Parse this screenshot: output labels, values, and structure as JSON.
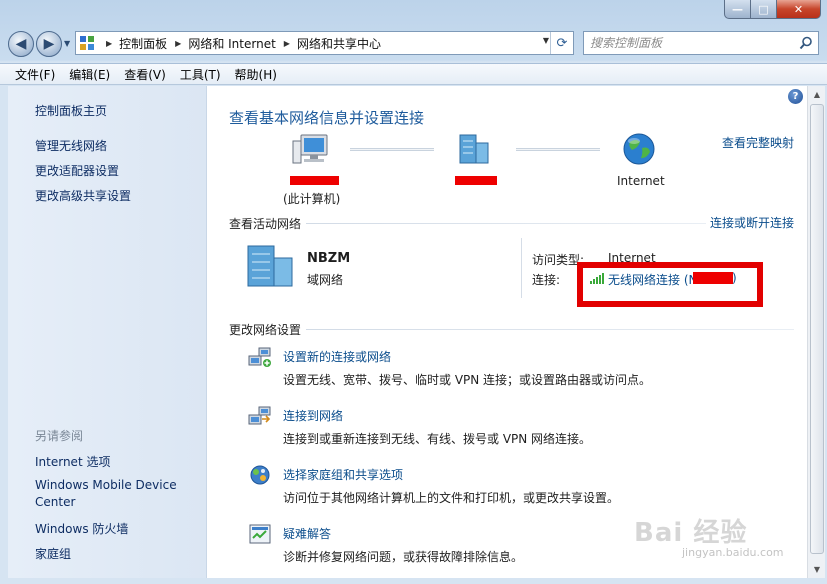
{
  "window": {
    "caption": {
      "minimize": "—",
      "maximize": "□",
      "close": "✕"
    }
  },
  "nav": {
    "back_icon": "back-arrow-icon",
    "forward_icon": "forward-arrow-icon",
    "breadcrumb": [
      "控制面板",
      "网络和 Internet",
      "网络和共享中心"
    ],
    "search_placeholder": "搜索控制面板"
  },
  "menu": [
    "文件(F)",
    "编辑(E)",
    "查看(V)",
    "工具(T)",
    "帮助(H)"
  ],
  "sidebar": {
    "top_links": [
      "控制面板主页",
      "管理无线网络",
      "更改适配器设置",
      "更改高级共享设置"
    ],
    "see_also_title": "另请参阅",
    "see_also": [
      "Internet 选项",
      "Windows Mobile Device",
      "Center",
      "Windows 防火墙",
      "家庭组"
    ]
  },
  "main": {
    "title": "查看基本网络信息并设置连接",
    "view_full_map": "查看完整映射",
    "map": {
      "this_computer": "(此计算机)",
      "internet": "Internet"
    },
    "active_title": "查看活动网络",
    "connect_disconnect": "连接或断开连接",
    "network": {
      "name": "NBZM",
      "type": "域网络",
      "access_label": "访问类型:",
      "access_value": "Internet",
      "connection_label": "连接:",
      "connection_value": "无线网络连接 (N",
      "connection_close": ")"
    },
    "change_title": "更改网络设置",
    "tasks": [
      {
        "title": "设置新的连接或网络",
        "desc": "设置无线、宽带、拨号、临时或 VPN 连接；或设置路由器或访问点。",
        "icon": "new-connection-icon"
      },
      {
        "title": "连接到网络",
        "desc": "连接到或重新连接到无线、有线、拨号或 VPN 网络连接。",
        "icon": "connect-network-icon"
      },
      {
        "title": "选择家庭组和共享选项",
        "desc": "访问位于其他网络计算机上的文件和打印机，或更改共享设置。",
        "icon": "homegroup-icon"
      },
      {
        "title": "疑难解答",
        "desc": "诊断并修复网络问题，或获得故障排除信息。",
        "icon": "troubleshoot-icon"
      }
    ]
  },
  "watermark": {
    "main": "Bai 经验",
    "sub": "jingyan.baidu.com"
  },
  "colors": {
    "link": "#0b4d8c",
    "title": "#1e5b9c",
    "redaction": "#ee0000"
  }
}
